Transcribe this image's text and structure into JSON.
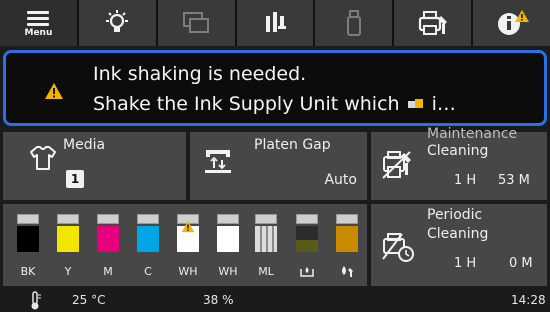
{
  "toolbar": {
    "menu_label": "Menu",
    "buttons": [
      {
        "icon": "menu-icon"
      },
      {
        "icon": "light-bulb-icon"
      },
      {
        "icon": "window-icon"
      },
      {
        "icon": "nozzle-icon"
      },
      {
        "icon": "usb-drive-icon"
      },
      {
        "icon": "printer-maintenance-icon"
      },
      {
        "icon": "info-alert-icon"
      }
    ]
  },
  "alert": {
    "line1": "Ink shaking is needed.",
    "line2_start": "Shake the Ink Supply Unit which",
    "line2_end": "i…",
    "icon": "warning-icon",
    "accent": "#2f6fe4",
    "warning_color": "#f4b400"
  },
  "media": {
    "label": "Media",
    "value": "1",
    "icon": "shirt-icon"
  },
  "platen": {
    "label": "Platen Gap",
    "value": "Auto",
    "icon": "platen-gap-icon"
  },
  "maintenance": {
    "label_top": "Maintenance",
    "label": "Cleaning",
    "hours": "1 H",
    "minutes": "53 M",
    "icon": "maintenance-cleaning-icon"
  },
  "periodic": {
    "label_top": "Periodic",
    "label": "Cleaning",
    "hours": "1 H",
    "minutes": "0 M",
    "icon": "periodic-cleaning-icon"
  },
  "inks": [
    {
      "label": "BK",
      "color": "#000000",
      "level": 1.0
    },
    {
      "label": "Y",
      "color": "#f2e600",
      "level": 1.0
    },
    {
      "label": "M",
      "color": "#e6007e",
      "level": 1.0
    },
    {
      "label": "C",
      "color": "#00a6e6",
      "level": 1.0
    },
    {
      "label": "WH",
      "color": "#ffffff",
      "level": 1.0,
      "warning": true
    },
    {
      "label": "WH",
      "color": "#ffffff",
      "level": 1.0
    },
    {
      "label": "ML",
      "color": "#dcdcdc",
      "level": 1.0
    },
    {
      "label": "",
      "color": "#5a5a1a",
      "level": 0.45,
      "icon": "waste-ink-icon"
    },
    {
      "label": "",
      "color": "#c98a00",
      "level": 1.0,
      "icon": "cleaning-liquid-icon"
    }
  ],
  "status": {
    "temperature": "25 °C",
    "humidity": "38 %",
    "time": "14:28",
    "icon": "thermometer-icon"
  }
}
